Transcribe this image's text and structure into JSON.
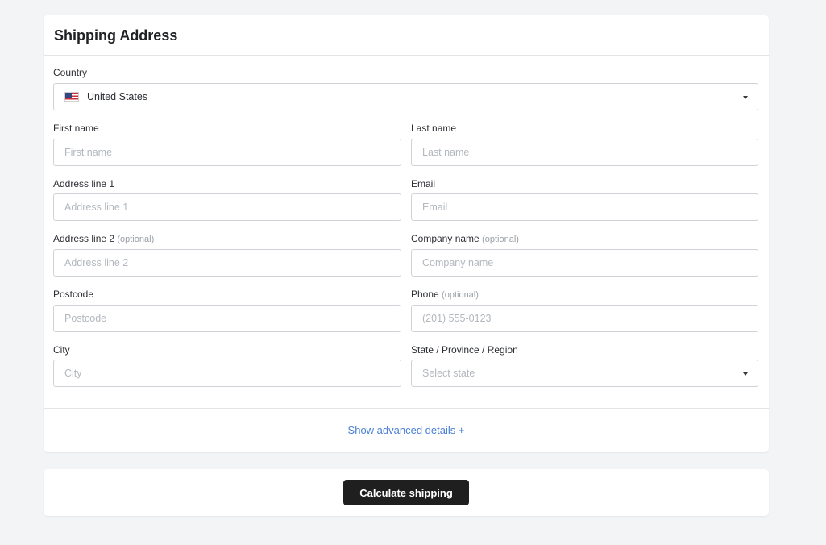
{
  "card": {
    "title": "Shipping Address"
  },
  "fields": {
    "country": {
      "label": "Country",
      "value": "United States",
      "flag_icon": "us-flag-icon"
    },
    "first_name": {
      "label": "First name",
      "placeholder": "First name"
    },
    "last_name": {
      "label": "Last name",
      "placeholder": "Last name"
    },
    "address1": {
      "label": "Address line 1",
      "placeholder": "Address line 1"
    },
    "email": {
      "label": "Email",
      "placeholder": "Email"
    },
    "address2": {
      "label": "Address line 2",
      "optional": "(optional)",
      "placeholder": "Address line 2"
    },
    "company": {
      "label": "Company name",
      "optional": "(optional)",
      "placeholder": "Company name"
    },
    "postcode": {
      "label": "Postcode",
      "placeholder": "Postcode"
    },
    "phone": {
      "label": "Phone",
      "optional": "(optional)",
      "placeholder": "(201) 555-0123"
    },
    "city": {
      "label": "City",
      "placeholder": "City"
    },
    "state": {
      "label": "State / Province / Region",
      "placeholder": "Select state"
    }
  },
  "advanced_link": "Show advanced details +",
  "actions": {
    "calculate_label": "Calculate shipping"
  },
  "colors": {
    "background": "#f3f4f6",
    "link": "#4a7fd6",
    "button": "#1f1f1f"
  }
}
